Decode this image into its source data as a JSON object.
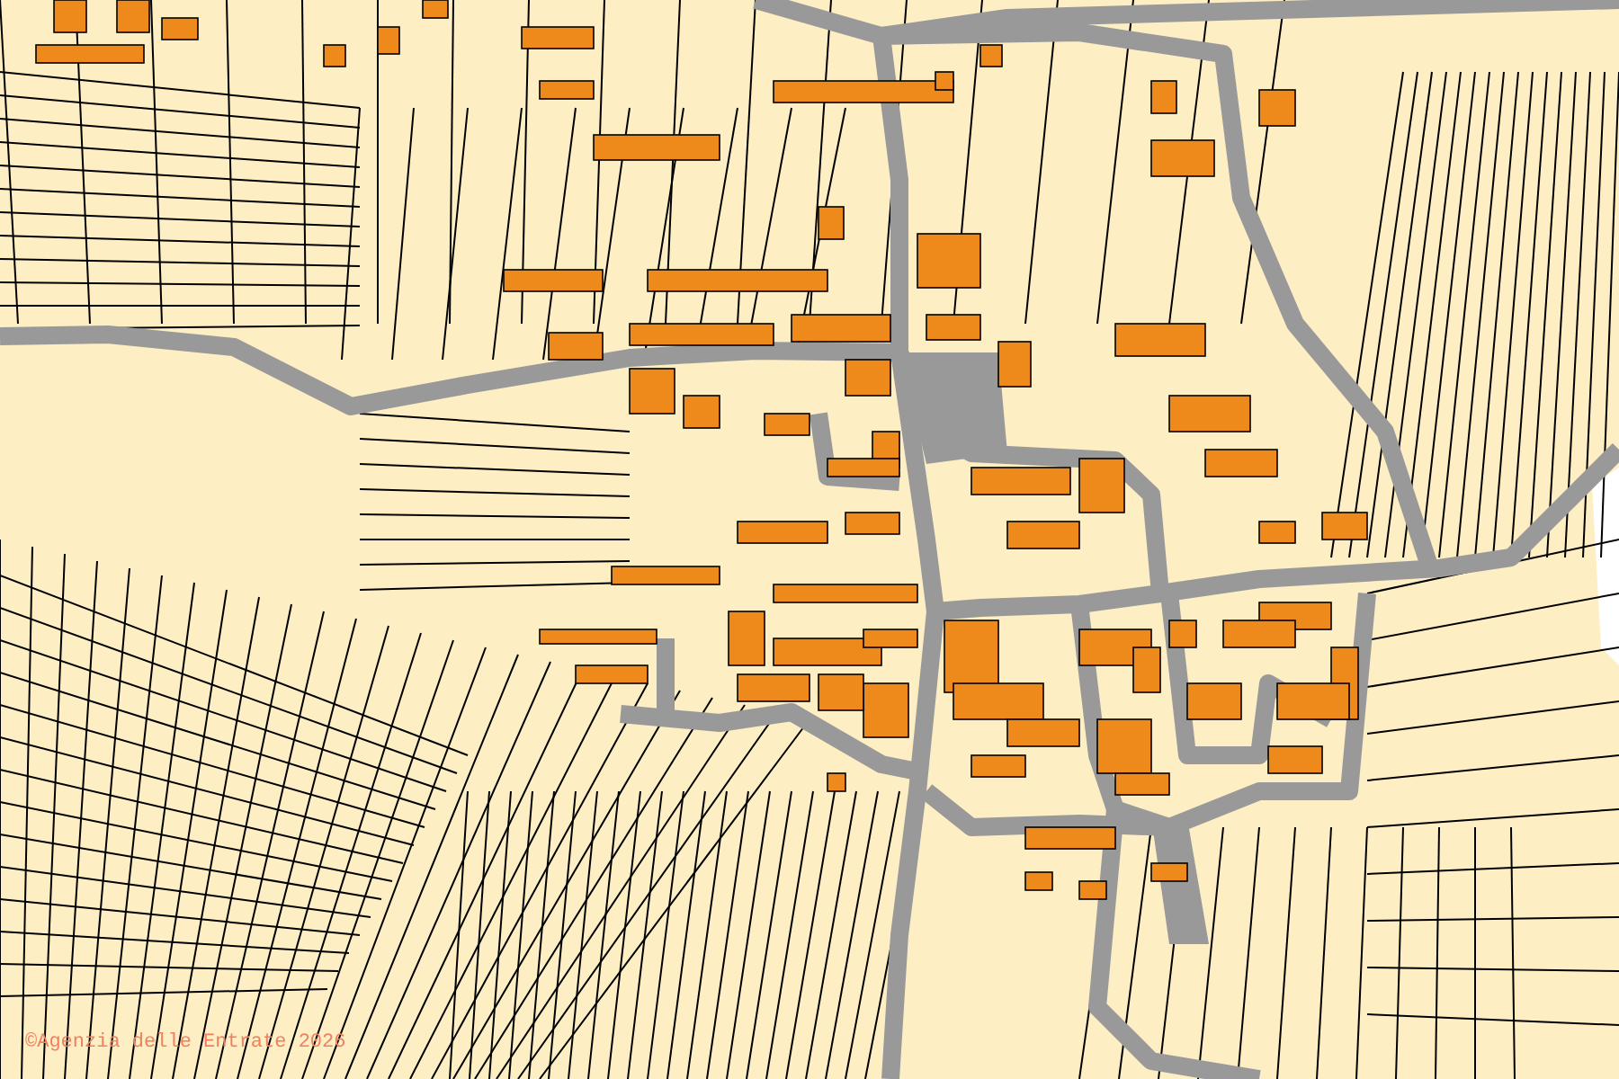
{
  "map": {
    "attribution": "©Agenzia delle Entrate 2026"
  }
}
